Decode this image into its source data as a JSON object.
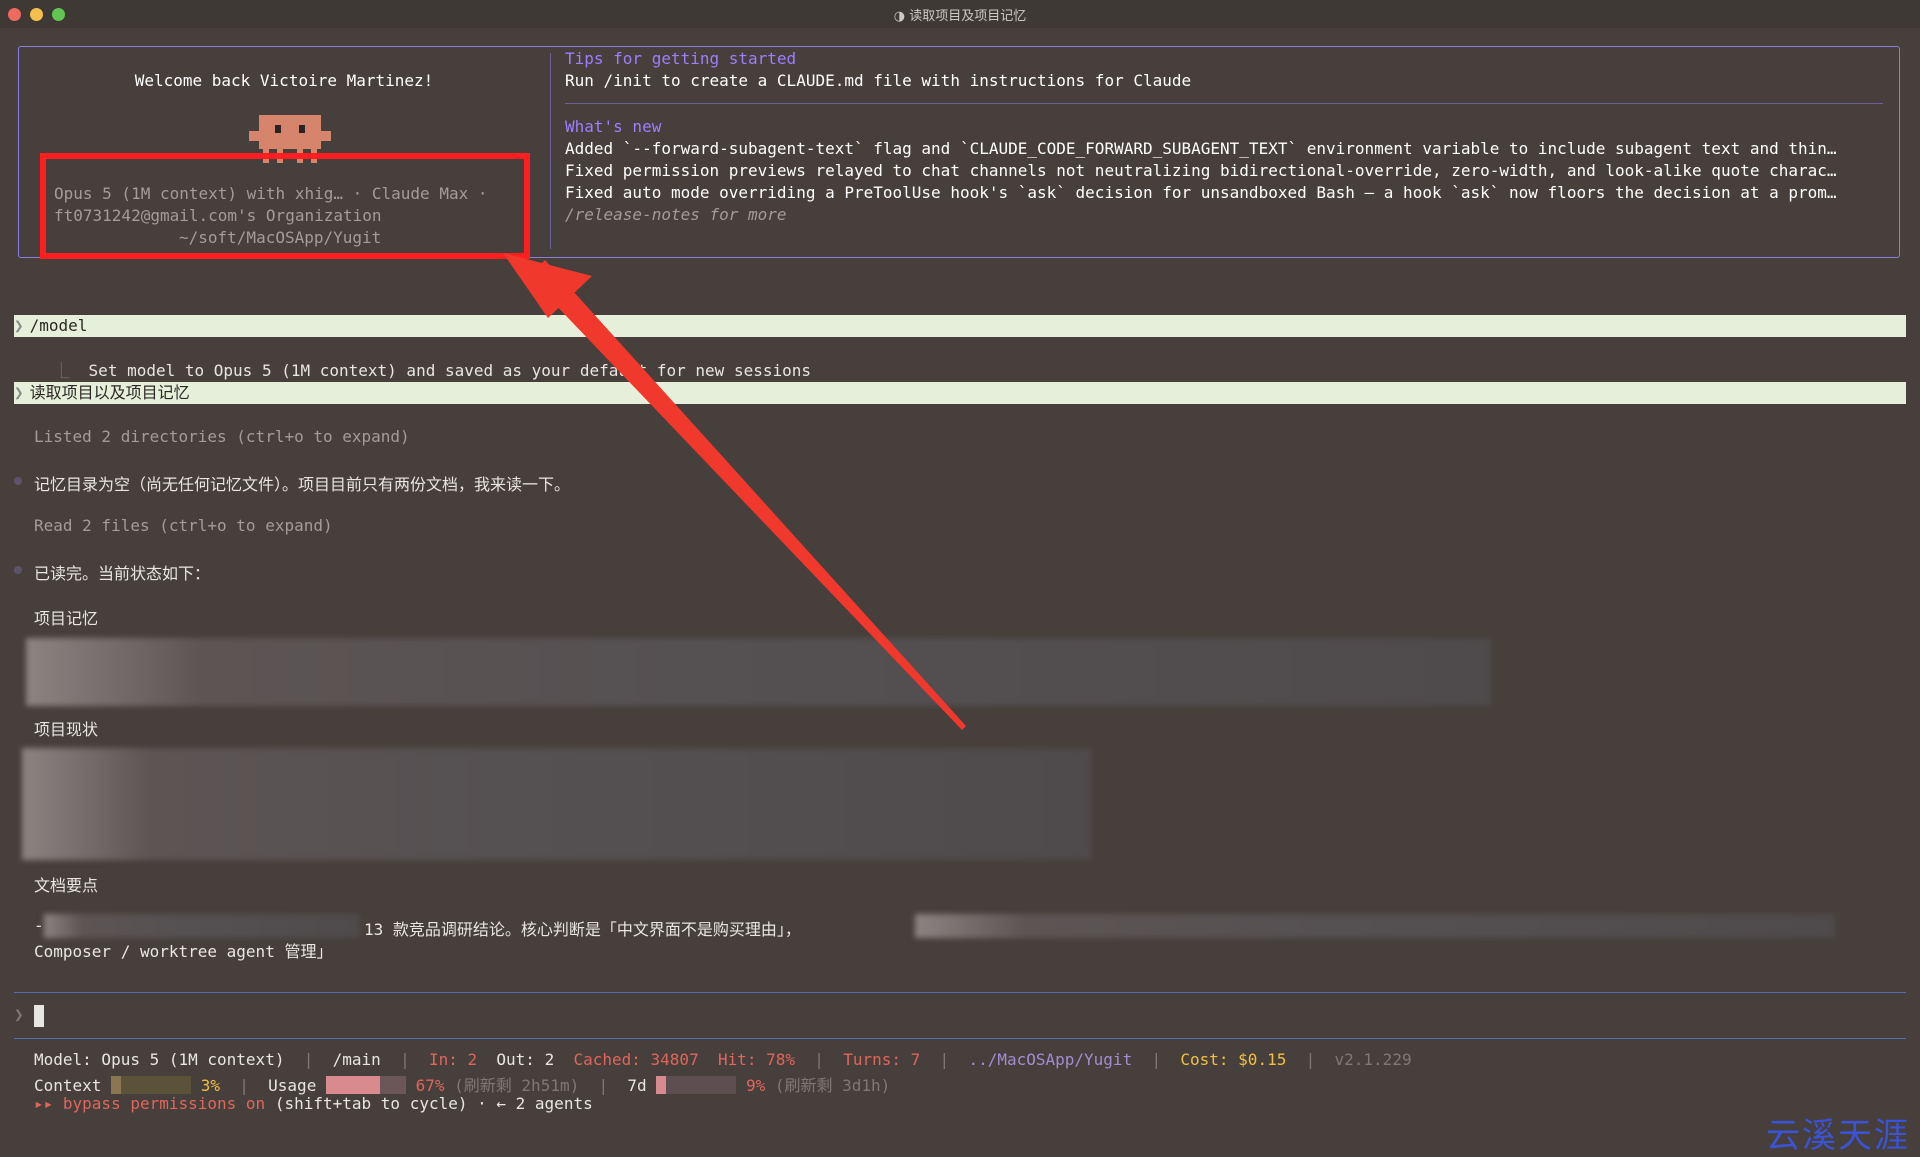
{
  "window": {
    "title": "◑ 读取项目及项目记忆"
  },
  "welcome": {
    "greeting": "Welcome back Victoire Martinez!",
    "model_line": "Opus 5 (1M context) with xhig… · Claude Max ·",
    "org_line": "ft0731242@gmail.com's Organization",
    "path_line": "~/soft/MacOSApp/Yugit"
  },
  "tips": {
    "heading": "Tips for getting started",
    "line": "Run /init to create a CLAUDE.md file with instructions for Claude"
  },
  "whats_new": {
    "heading": "What's new",
    "items": [
      "Added `--forward-subagent-text` flag and `CLAUDE_CODE_FORWARD_SUBAGENT_TEXT` environment variable to include subagent text and thin…",
      "Fixed permission previews relayed to chat channels not neutralizing bidirectional-override, zero-width, and look-alike quote charac…",
      "Fixed auto mode overriding a PreToolUse hook's `ask` decision for unsandboxed Bash — a hook `ask` now floors the decision at a prom…"
    ],
    "more": "/release-notes for more"
  },
  "transcript": {
    "cmd1": "/model",
    "cmd1_result": "Set model to Opus 5 (1M context) and saved as your default for new sessions",
    "cmd2": "读取项目以及项目记忆",
    "listed": "Listed 2 directories (ctrl+o to expand)",
    "msg1": "记忆目录为空（尚无任何记忆文件）。项目目前只有两份文档，我来读一下。",
    "read": "Read 2 files (ctrl+o to expand)",
    "msg2": "已读完。当前状态如下：",
    "h_memory": "项目记忆",
    "h_status": "项目现状",
    "h_docs": "文档要点",
    "doc_dash": "-",
    "doc_line1": "13 款竞品调研结论。核心判断是「中文界面不是购买理由」，",
    "doc_line2": "Composer / worktree agent 管理」"
  },
  "input": {
    "prompt": "❯"
  },
  "status": {
    "model": "Model: Opus 5 (1M context)",
    "branch": "/main",
    "in": "In: 2",
    "out": "Out: 2",
    "cached": "Cached: 34807",
    "hit": "Hit: 78%",
    "turns": "Turns: 7",
    "path": "../MacOSApp/Yugit",
    "cost": "Cost: $0.15",
    "version": "v2.1.229",
    "sep": "|",
    "context_label": "Context",
    "context_pct": "3%",
    "usage_label": "Usage",
    "usage_pct": "67%",
    "usage_reset": "(刷新剩 2h51m)",
    "week_label": "7d",
    "week_pct": "9%",
    "week_reset": "(刷新剩 3d1h)",
    "context_level": 0.03,
    "usage_level": 0.67,
    "week_level": 0.09,
    "bypass": "▸▸ bypass permissions on",
    "bypass_hint": "(shift+tab to cycle) · ← 2 agents"
  },
  "watermark": "云溪天涯",
  "colors": {
    "accent_border": "#8a7fd6",
    "prompt_bg": "#e5efd9",
    "annotation_red": "#ff1f1f"
  }
}
